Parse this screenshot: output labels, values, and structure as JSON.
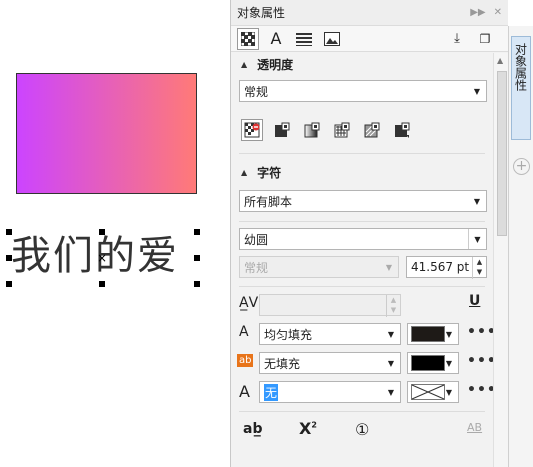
{
  "canvas": {
    "artistic_text": "我们的爱"
  },
  "panel": {
    "title": "对象属性",
    "side_tab_label": "对象属性",
    "tabs": [
      "fill-pattern-icon",
      "A",
      "paragraph-icon",
      "picture-icon"
    ],
    "transparency": {
      "heading": "透明度",
      "mode_value": "常规"
    },
    "character": {
      "heading": "字符",
      "script_value": "所有脚本",
      "font_value": "幼圆",
      "style_value": "常规",
      "size_value": "41.567 pt",
      "fill_type": "均匀填充",
      "bg_fill_type": "无填充",
      "outline_value": "无",
      "fill_color": "#1e1a17",
      "bg_color": "#000000"
    },
    "more_label": "•••",
    "small_icons": {
      "underline": "U",
      "caps": "AB"
    }
  }
}
